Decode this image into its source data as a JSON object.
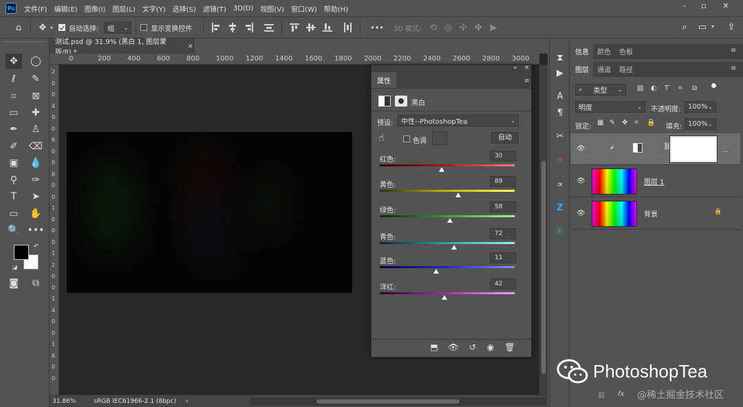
{
  "menubar": {
    "logo": "Ps",
    "items": [
      "文件(F)",
      "编辑(E)",
      "图像(I)",
      "图层(L)",
      "文字(Y)",
      "选择(S)",
      "滤镜(T)",
      "3D(D)",
      "视图(V)",
      "窗口(W)",
      "帮助(H)"
    ]
  },
  "optbar": {
    "auto_select_label": "自动选择:",
    "auto_select_value": "组",
    "show_transform_label": "显示变换控件",
    "mode_3d_label": "3D 模式:",
    "more": "•••"
  },
  "document": {
    "tab_title": "测试.psd @ 31.9% (黑白 1, 图层蒙版/8) *",
    "close": "×",
    "ruler_top": [
      "0",
      "200",
      "400",
      "600",
      "800",
      "1000",
      "1200",
      "1400",
      "1600",
      "1800",
      "2000",
      "2200",
      "2400",
      "2600",
      "2800",
      "3000"
    ],
    "ruler_left": [
      "2",
      "0",
      "0",
      "4",
      "0",
      "0",
      "6",
      "0",
      "0",
      "8",
      "0",
      "0",
      "1",
      "0",
      "0",
      "0",
      "1",
      "2",
      "0",
      "0",
      "1",
      "4",
      "0",
      "0",
      "1",
      "6",
      "0",
      "0"
    ],
    "zoom": "31.86%",
    "color_profile": "sRGB IEC61966-2.1 (8bpc)",
    "status_arrow": "›"
  },
  "properties": {
    "tab": "属性",
    "type_label": "黑白",
    "preset_label": "预设:",
    "preset_value": "中性--PhotoshopTea",
    "tint_label": "色调",
    "auto_button": "自动",
    "sliders": [
      {
        "label": "红色:",
        "value": "30",
        "fraction": 0.46
      },
      {
        "label": "黄色:",
        "value": "89",
        "fraction": 0.58
      },
      {
        "label": "绿色:",
        "value": "58",
        "fraction": 0.52
      },
      {
        "label": "青色:",
        "value": "72",
        "fraction": 0.55
      },
      {
        "label": "蓝色:",
        "value": "11",
        "fraction": 0.42
      },
      {
        "label": "洋红:",
        "value": "42",
        "fraction": 0.48
      }
    ]
  },
  "rightpanel": {
    "info_tabs": [
      "信息",
      "颜色",
      "色板"
    ],
    "layer_tabs": [
      "图层",
      "通道",
      "路径"
    ],
    "filter_label": "类型",
    "blend_mode": "明度",
    "opacity_label": "不透明度:",
    "opacity_value": "100%",
    "lock_label": "锁定:",
    "fill_label": "填充:",
    "fill_value": "100%",
    "layers": [
      {
        "name": "",
        "type": "adjustment"
      },
      {
        "name": "图层 1",
        "type": "pixel"
      },
      {
        "name": "背景",
        "type": "background"
      }
    ],
    "footer_fx": "fx"
  },
  "watermark": {
    "brand": "PhotoshopTea",
    "community": "@稀土掘金技术社区"
  }
}
